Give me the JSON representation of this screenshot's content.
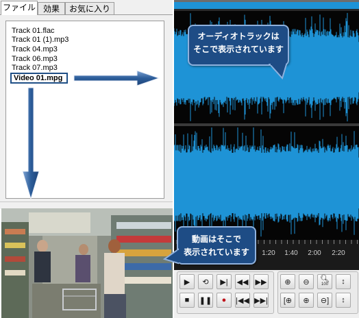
{
  "tabs": [
    "ファイル",
    "効果",
    "お気に入り"
  ],
  "tracks": [
    {
      "label": "Track 01.flac"
    },
    {
      "label": "Track 01 (1).mp3"
    },
    {
      "label": "Track 04.mp3"
    },
    {
      "label": "Track 06.mp3"
    },
    {
      "label": "Track 07.mp3"
    },
    {
      "label": "Video 01.mpg"
    }
  ],
  "callouts": {
    "audio_line1": "オーディオトラックは",
    "audio_line2": "そこで表示されています",
    "video_line1": "動画はそこで",
    "video_line2": "表示されています"
  },
  "timeline": {
    "ticks": [
      "1:20",
      "1:40",
      "2:00",
      "2:20"
    ]
  },
  "colors": {
    "waveform": "#1e93d6",
    "waveform_bg": "#050505",
    "callout": "#1e4c85",
    "selection": "#1f4f86"
  },
  "icons": {
    "playback": [
      "play-icon",
      "loop-icon",
      "play-selection-icon",
      "rewind-icon",
      "fast-forward-icon"
    ],
    "transport": [
      "stop-icon",
      "pause-icon",
      "record-icon",
      "go-to-start-icon",
      "go-to-end-icon"
    ],
    "zoom_top": [
      "zoom-in-icon",
      "zoom-out-icon",
      "zoom-100-icon",
      "zoom-vertical-icon"
    ],
    "zoom_bottom": [
      "zoom-selection-icon",
      "zoom-in-full-icon",
      "zoom-out-full-icon",
      "zoom-fit-icon"
    ]
  },
  "zoom_100_label": "100"
}
